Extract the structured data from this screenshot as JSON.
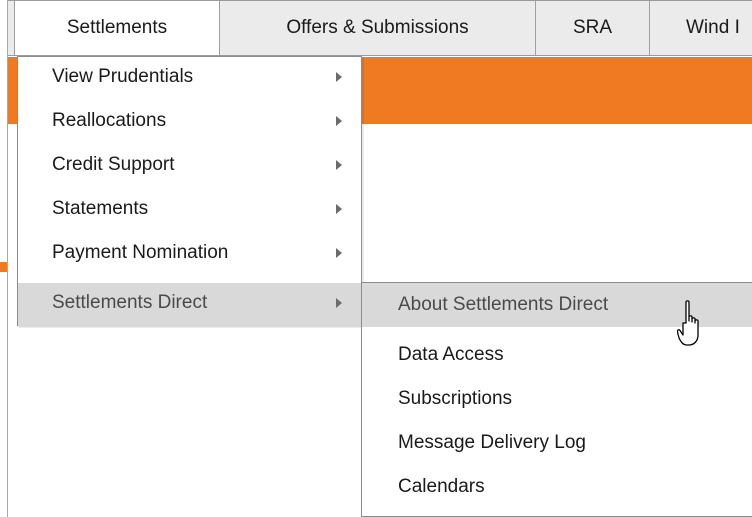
{
  "menubar": {
    "items": [
      {
        "label": "Settlements"
      },
      {
        "label": "Offers & Submissions"
      },
      {
        "label": "SRA"
      },
      {
        "label": "Wind I"
      }
    ]
  },
  "dropdown": {
    "items": [
      {
        "label": "View Prudentials"
      },
      {
        "label": "Reallocations"
      },
      {
        "label": "Credit Support"
      },
      {
        "label": "Statements"
      },
      {
        "label": "Payment Nomination"
      },
      {
        "label": "Settlements Direct"
      }
    ]
  },
  "submenu": {
    "items": [
      {
        "label": "About Settlements Direct"
      },
      {
        "label": "Data Access"
      },
      {
        "label": "Subscriptions"
      },
      {
        "label": "Message Delivery Log"
      },
      {
        "label": "Calendars"
      }
    ]
  },
  "colors": {
    "accent": "#f07a21",
    "menubar_bg": "#ebebeb",
    "highlight": "#d9d9d9"
  },
  "icons": {
    "submenu_arrow": "triangle-right-icon",
    "cursor": "hand-pointer-icon"
  }
}
